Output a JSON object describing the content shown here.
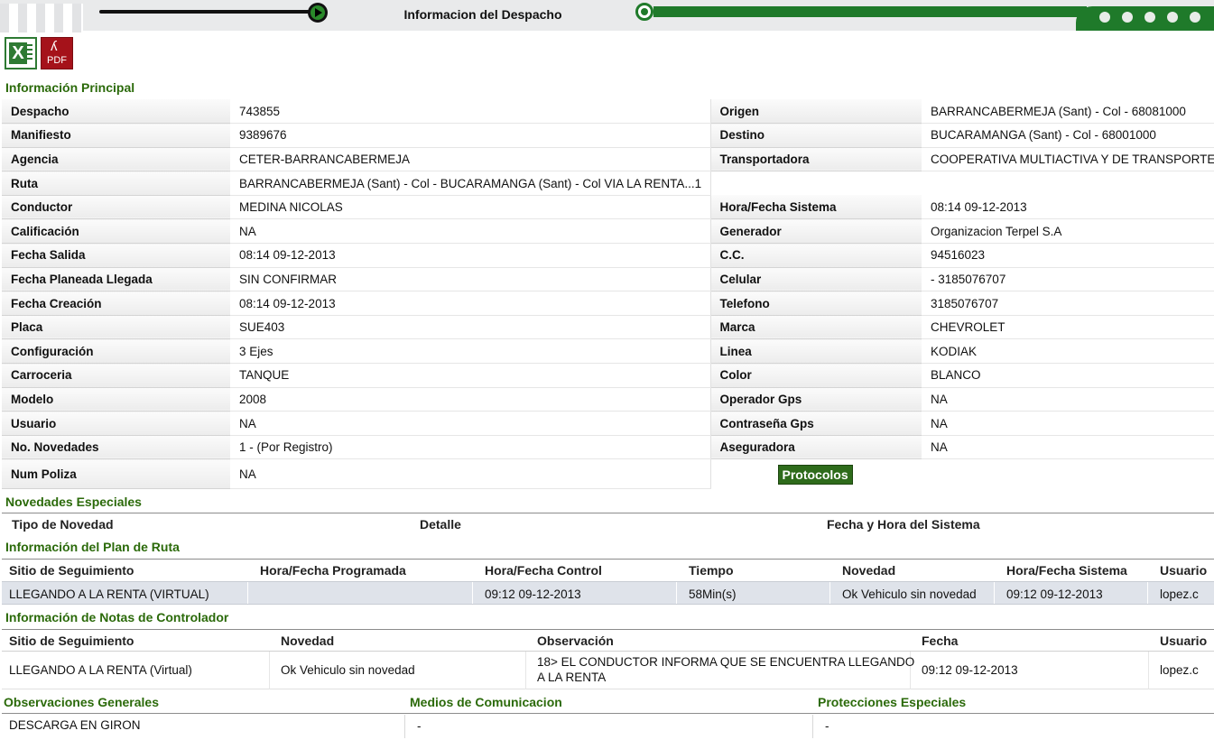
{
  "header": {
    "title": "Informacion del Despacho"
  },
  "export": {
    "excel_icon": "excel-icon",
    "pdf_icon": "pdf-icon",
    "pdf_label": "PDF"
  },
  "sections": {
    "principal": "Información Principal",
    "novedades": "Novedades Especiales",
    "plan_ruta": "Información del Plan de Ruta",
    "notas": "Información de Notas de Controlador"
  },
  "info": {
    "rows": [
      {
        "l1": "Despacho",
        "v1": "743855",
        "l2": "Origen",
        "v2": "BARRANCABERMEJA (Sant) - Col - 68081000"
      },
      {
        "l1": "Manifiesto",
        "v1": "9389676",
        "l2": "Destino",
        "v2": "BUCARAMANGA (Sant) - Col - 68001000"
      },
      {
        "l1": "Agencia",
        "v1": "CETER-BARRANCABERMEJA",
        "l2": "Transportadora",
        "v2": "COOPERATIVA MULTIACTIVA Y DE TRANSPORTE"
      },
      {
        "l1": "Ruta",
        "v1": "BARRANCABERMEJA (Sant) - Col - BUCARAMANGA (Sant) - Col VIA LA RENTA...1",
        "l2": "",
        "v2": ""
      },
      {
        "l1": "Conductor",
        "v1": "MEDINA NICOLAS",
        "l2": "Hora/Fecha Sistema",
        "v2": "08:14 09-12-2013"
      },
      {
        "l1": "Calificación",
        "v1": "NA",
        "l2": "Generador",
        "v2": "Organizacion Terpel S.A"
      },
      {
        "l1": "Fecha Salida",
        "v1": "08:14 09-12-2013",
        "l2": "C.C.",
        "v2": "94516023"
      },
      {
        "l1": "Fecha Planeada Llegada",
        "v1": "SIN CONFIRMAR",
        "l2": "Celular",
        "v2": "- 3185076707"
      },
      {
        "l1": "Fecha Creación",
        "v1": "08:14 09-12-2013",
        "l2": "Telefono",
        "v2": "3185076707"
      },
      {
        "l1": "Placa",
        "v1": "SUE403",
        "l2": "Marca",
        "v2": "CHEVROLET"
      },
      {
        "l1": "Configuración",
        "v1": "3 Ejes",
        "l2": "Linea",
        "v2": "KODIAK"
      },
      {
        "l1": "Carroceria",
        "v1": "TANQUE",
        "l2": "Color",
        "v2": "BLANCO"
      },
      {
        "l1": "Modelo",
        "v1": "2008",
        "l2": "Operador Gps",
        "v2": "NA"
      },
      {
        "l1": "Usuario",
        "v1": "NA",
        "l2": "Contraseña Gps",
        "v2": "NA"
      },
      {
        "l1": "No. Novedades",
        "v1": "1 - (Por Registro)",
        "l2": "Aseguradora",
        "v2": "NA"
      },
      {
        "l1": "Num Poliza",
        "v1": "NA",
        "l2": "",
        "v2": ""
      }
    ],
    "protocolos_label": "Protocolos"
  },
  "novedades": {
    "headers": [
      "Tipo de Novedad",
      "Detalle",
      "Fecha y Hora del Sistema"
    ]
  },
  "plan_ruta": {
    "headers": [
      "Sitio de Seguimiento",
      "Hora/Fecha Programada",
      "Hora/Fecha Control",
      "Tiempo",
      "Novedad",
      "Hora/Fecha Sistema",
      "Usuario"
    ],
    "rows": [
      [
        "LLEGANDO A LA RENTA (VIRTUAL)",
        "",
        "09:12 09-12-2013",
        "58Min(s)",
        "Ok Vehiculo sin novedad",
        "09:12 09-12-2013",
        "lopez.c"
      ]
    ]
  },
  "notas": {
    "headers": [
      "Sitio de Seguimiento",
      "Novedad",
      "Observación",
      "Fecha",
      "Usuario"
    ],
    "rows": [
      {
        "sitio": "LLEGANDO A LA RENTA (Virtual)",
        "novedad": "Ok Vehiculo sin novedad",
        "obs_line1": "18> EL CONDUCTOR INFORMA QUE SE ENCUENTRA LLEGANDO",
        "obs_line2": "A LA RENTA",
        "fecha": "09:12 09-12-2013",
        "usuario": "lopez.c"
      }
    ]
  },
  "observaciones": {
    "headers": [
      "Observaciones Generales",
      "Medios de Comunicacion",
      "Protecciones Especiales"
    ],
    "values": [
      "DESCARGA EN GIRON",
      "-",
      "-"
    ]
  },
  "colors": {
    "section_title": "#2b6a0a",
    "accent_green": "#1f7a2a",
    "button_green": "#2e6b1b",
    "plan_row_bg": "#dfe3ea"
  }
}
